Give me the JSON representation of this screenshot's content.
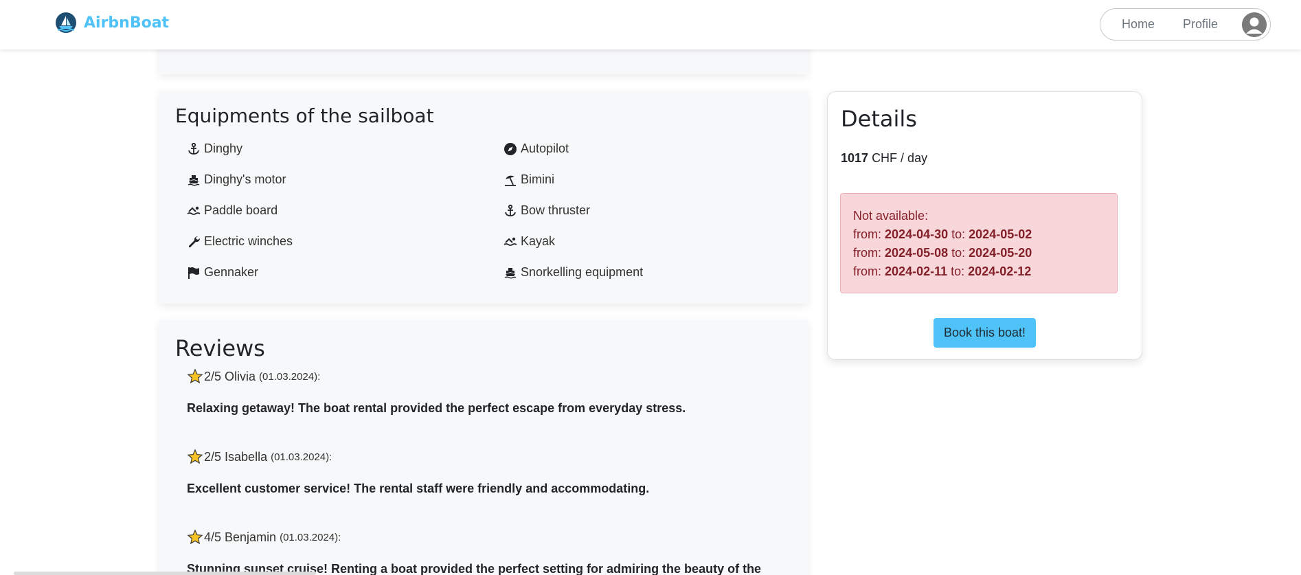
{
  "brand": {
    "name": "AirbnBoat",
    "color": "#4fc3f7"
  },
  "nav": {
    "home": "Home",
    "profile": "Profile"
  },
  "equipments": {
    "title": "Equipments of the sailboat",
    "left": [
      {
        "label": "Dinghy",
        "icon": "anchor-icon"
      },
      {
        "label": "Dinghy's motor",
        "icon": "ship-icon"
      },
      {
        "label": "Paddle board",
        "icon": "swimmer-icon"
      },
      {
        "label": "Electric winches",
        "icon": "wrench-icon"
      },
      {
        "label": "Gennaker",
        "icon": "flag-icon"
      }
    ],
    "right": [
      {
        "label": "Autopilot",
        "icon": "compass-icon"
      },
      {
        "label": "Bimini",
        "icon": "umbrella-beach-icon"
      },
      {
        "label": "Bow thruster",
        "icon": "anchor-icon"
      },
      {
        "label": "Kayak",
        "icon": "swimmer-icon"
      },
      {
        "label": "Snorkelling equipment",
        "icon": "ship-icon"
      }
    ]
  },
  "reviews": {
    "title": "Reviews",
    "items": [
      {
        "rating": "2/5",
        "author": "Olivia",
        "date": "(01.03.2024):",
        "text": "Relaxing getaway! The boat rental provided the perfect escape from everyday stress."
      },
      {
        "rating": "2/5",
        "author": "Isabella",
        "date": "(01.03.2024):",
        "text": "Excellent customer service! The rental staff were friendly and accommodating."
      },
      {
        "rating": "4/5",
        "author": "Benjamin",
        "date": "(01.03.2024):",
        "text": "Stunning sunset cruise! Renting a boat provided the perfect setting for admiring the beauty of the"
      }
    ]
  },
  "details": {
    "title": "Details",
    "price_value": "1017",
    "price_unit": "CHF / day",
    "not_available_label": "Not available:",
    "from_label": "from:",
    "to_label": "to:",
    "unavailable": [
      {
        "from": "2024-04-30",
        "to": "2024-05-02"
      },
      {
        "from": "2024-05-08",
        "to": "2024-05-20"
      },
      {
        "from": "2024-02-11",
        "to": "2024-02-12"
      }
    ],
    "book_label": "Book this boat!",
    "book_color": "#4fc3f7"
  }
}
